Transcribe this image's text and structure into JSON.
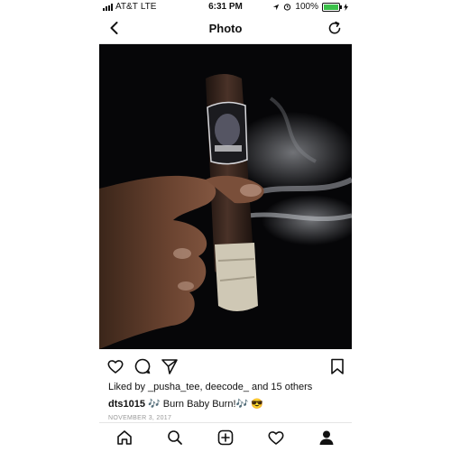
{
  "status_bar": {
    "carrier": "AT&T",
    "network": "LTE",
    "time": "6:31 PM",
    "battery": "100%",
    "battery_color": "#3bc14a"
  },
  "nav": {
    "title": "Photo",
    "back_icon": "chevron-left-icon",
    "refresh_icon": "refresh-icon"
  },
  "post": {
    "likes_text": "Liked by _pusha_tee, deecode_ and 15 others",
    "caption_user": "dts1015",
    "caption_text": "🎶 Burn Baby Burn!🎶 😎",
    "date": "NOVEMBER 3, 2017"
  },
  "tabs": [
    "home-icon",
    "search-icon",
    "add-post-icon",
    "activity-heart-icon",
    "profile-icon"
  ]
}
